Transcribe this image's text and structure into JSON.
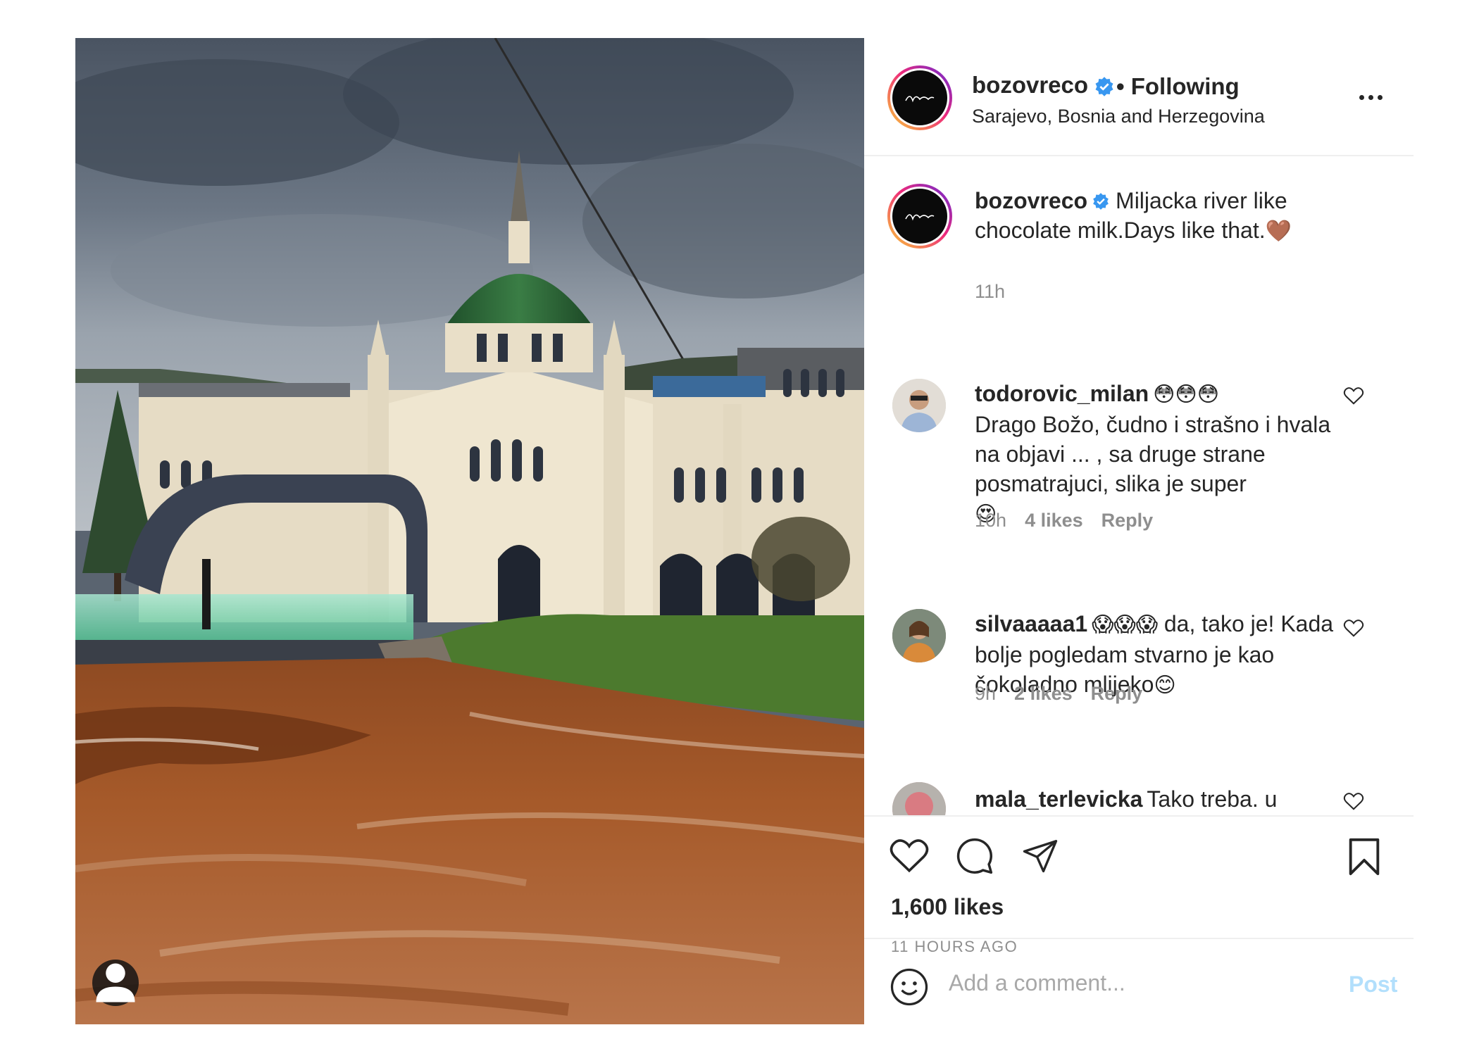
{
  "post": {
    "username": "bozovreco",
    "separator": "•",
    "follow_status": "Following",
    "location": "Sarajevo, Bosnia and Herzegovina",
    "caption": "Miljacka river like chocolate milk.Days like that.",
    "caption_emoji": "🤎",
    "caption_time": "11h",
    "likes": "1,600 likes",
    "posted": "11 HOURS AGO"
  },
  "comments": [
    {
      "username": "todorovic_milan",
      "text_emoji": "😳😳😳",
      "text": "Drago Božo, čudno i strašno i hvala na objavi ... , sa druge strane posmatrajuci, slika je super",
      "trailing_emoji": "😍",
      "time": "10h",
      "likes": "4 likes",
      "reply": "Reply"
    },
    {
      "username": "silvaaaaa1",
      "text_emoji": "😱😱😱",
      "text": "da, tako je! Kada bolje pogledam stvarno je kao čokoladno mlijeko",
      "trailing_emoji": "😊",
      "time": "9h",
      "likes": "2 likes",
      "reply": "Reply"
    },
    {
      "username": "mala_terlevicka",
      "text": "Tako treba. u"
    }
  ],
  "add_comment": {
    "placeholder": "Add a comment...",
    "post_label": "Post"
  },
  "icons": {
    "more": "more-options-icon",
    "verified": "verified-badge-icon",
    "like": "heart-icon",
    "comment": "comment-icon",
    "share": "paper-plane-icon",
    "save": "bookmark-icon",
    "emoji": "smiley-icon",
    "tag": "user-tag-icon"
  },
  "colors": {
    "accent_blue": "#3897f0",
    "post_disabled": "#b2dffc",
    "muted_text": "#8e8e8e",
    "dome_green": "#2f6b3a",
    "river_brown": "#a5572a"
  }
}
